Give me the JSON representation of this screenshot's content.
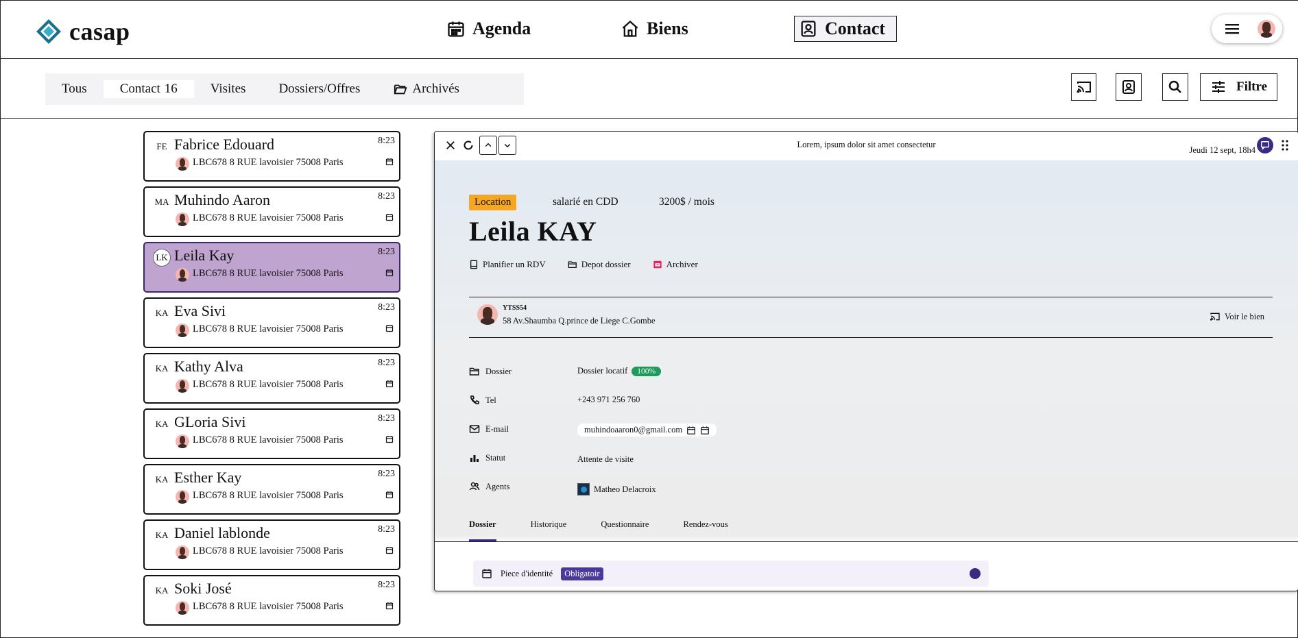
{
  "app": {
    "name": "casap"
  },
  "nav": {
    "agenda": "Agenda",
    "biens": "Biens",
    "contact": "Contact"
  },
  "filters": {
    "tous": "Tous",
    "contact": "Contact",
    "contact_count": "16",
    "visites": "Visites",
    "dossiers": "Dossiers/Offres",
    "archives": "Archivés",
    "filter_button": "Filtre"
  },
  "contacts": [
    {
      "initials": "FE",
      "name": "Fabrice Edouard",
      "time": "8:23",
      "address": "LBC678 8 RUE lavoisier 75008 Paris"
    },
    {
      "initials": "MA",
      "name": "Muhindo Aaron",
      "time": "8:23",
      "address": "LBC678 8 RUE lavoisier 75008 Paris"
    },
    {
      "initials": "LK",
      "name": "Leila Kay",
      "time": "8:23",
      "address": "LBC678 8 RUE lavoisier 75008 Paris"
    },
    {
      "initials": "KA",
      "name": "Eva Sivi",
      "time": "8:23",
      "address": "LBC678 8 RUE lavoisier 75008 Paris"
    },
    {
      "initials": "KA",
      "name": "Kathy Alva",
      "time": "8:23",
      "address": "LBC678 8 RUE lavoisier 75008 Paris"
    },
    {
      "initials": "KA",
      "name": "GLoria Sivi",
      "time": "8:23",
      "address": "LBC678 8 RUE lavoisier 75008 Paris"
    },
    {
      "initials": "KA",
      "name": "Esther Kay",
      "time": "8:23",
      "address": "LBC678 8 RUE lavoisier 75008 Paris"
    },
    {
      "initials": "KA",
      "name": "Daniel lablonde",
      "time": "8:23",
      "address": "LBC678 8 RUE lavoisier 75008 Paris"
    },
    {
      "initials": "KA",
      "name": "Soki José",
      "time": "8:23",
      "address": "LBC678 8 RUE lavoisier 75008 Paris"
    }
  ],
  "detail": {
    "title": "Lorem, ipsum dolor sit amet consectetur",
    "date": "Jeudi 12 sept, 18h4",
    "badge": "Location",
    "job": "salarié en CDD",
    "rent": "3200$ / mois",
    "name": "Leila KAY",
    "actions": {
      "rdv": "Planifier un RDV",
      "depot": "Depot dossier",
      "archiver": "Archiver"
    },
    "property": {
      "code": "YTSS54",
      "address": "58 Av.Shaumba Q.prince de Liege C.Gombe",
      "see": "Voir le bien"
    },
    "fields": {
      "dossier_label": "Dossier",
      "dossier_value": "Dossier locatif",
      "dossier_pct": "100%",
      "tel_label": "Tel",
      "tel_value": "+243 971 256 760",
      "email_label": "E-mail",
      "email_value": "muhindoaaron0@gmail.com",
      "statut_label": "Statut",
      "statut_value": "Attente de visite",
      "agents_label": "Agents",
      "agents_value": "Matheo Delacroix"
    },
    "tabs": [
      "Dossier",
      "Historique",
      "Questionnaire",
      "Rendez-vous"
    ],
    "document": {
      "name": "Piece d'identité",
      "tag": "Obligatoir"
    }
  },
  "colors": {
    "accent": "#3b2b82",
    "selected_card": "#bea4cf",
    "location_badge": "#f5a623",
    "success": "#1e9a5a"
  }
}
